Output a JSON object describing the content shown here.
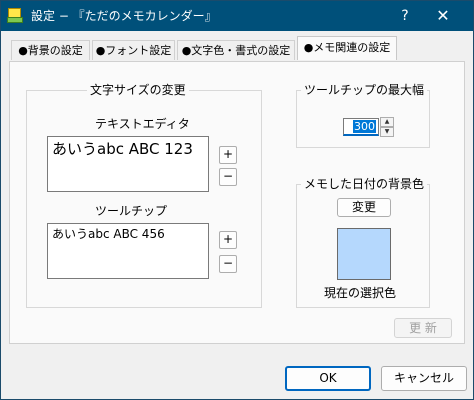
{
  "titlebar": {
    "title": "設定 − 『ただのメモカレンダー』",
    "help": "?",
    "close": "✕"
  },
  "tabs": [
    {
      "label": "●背景の設定"
    },
    {
      "label": "●フォント設定"
    },
    {
      "label": "●文字色・書式の設定"
    },
    {
      "label": "●メモ関連の設定"
    }
  ],
  "font_size_group": {
    "title": "文字サイズの変更",
    "text_editor": {
      "label": "テキストエディタ",
      "sample": "あいうabc ABC 123",
      "plus": "+",
      "minus": "−"
    },
    "tooltip": {
      "label": "ツールチップ",
      "sample": "あいうabc ABC 456",
      "plus": "+",
      "minus": "−"
    }
  },
  "tooltip_width_group": {
    "title": "ツールチップの最大幅",
    "value": "300",
    "up": "▲",
    "down": "▼"
  },
  "memo_color_group": {
    "title": "メモした日付の背景色",
    "change_button": "変更",
    "swatch_color": "#b5d8fd",
    "current_label": "現在の選択色"
  },
  "update_button": "更 新",
  "footer": {
    "ok": "OK",
    "cancel": "キャンセル"
  },
  "colors": {
    "titlebar": "#00507a",
    "accent": "#0067c0"
  }
}
